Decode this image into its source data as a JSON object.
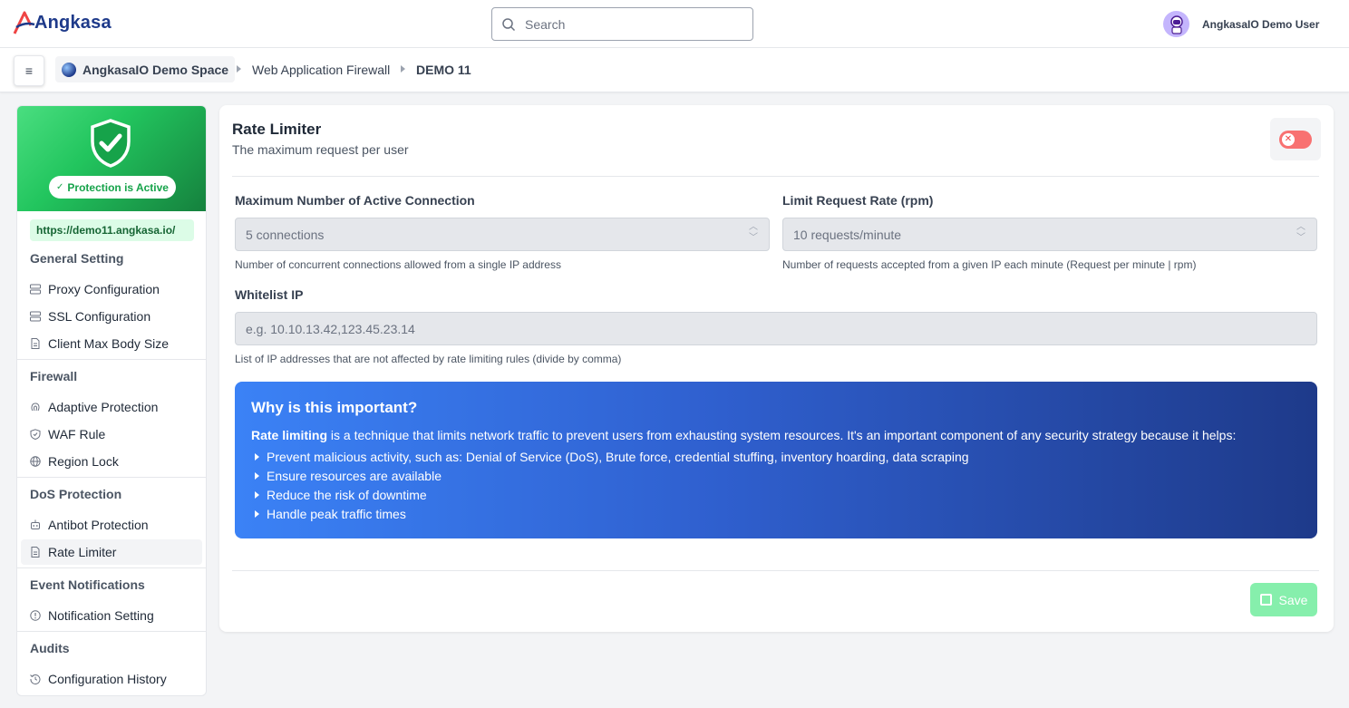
{
  "app": {
    "name": "Angkasa"
  },
  "search": {
    "placeholder": "Search"
  },
  "user": {
    "name": "AngkasaIO Demo User"
  },
  "breadcrumb": {
    "space": "AngkasaIO Demo Space",
    "items": [
      "Web Application Firewall",
      "DEMO 11"
    ]
  },
  "sidebar": {
    "status": "Protection is Active",
    "url": "https://demo11.angkasa.io/",
    "sections": [
      {
        "title": "General Setting",
        "items": [
          "Proxy Configuration",
          "SSL Configuration",
          "Client Max Body Size"
        ]
      },
      {
        "title": "Firewall",
        "items": [
          "Adaptive Protection",
          "WAF Rule",
          "Region Lock"
        ]
      },
      {
        "title": "DoS Protection",
        "items": [
          "Antibot Protection",
          "Rate Limiter"
        ]
      },
      {
        "title": "Event Notifications",
        "items": [
          "Notification Setting"
        ]
      },
      {
        "title": "Audits",
        "items": [
          "Configuration History"
        ]
      }
    ],
    "active_item": "Rate Limiter"
  },
  "main": {
    "title": "Rate Limiter",
    "subtitle": "The maximum request per user",
    "toggle_state": "off",
    "fields": {
      "max_conn": {
        "label": "Maximum Number of Active Connection",
        "value": "5 connections",
        "hint": "Number of concurrent connections allowed from a single IP address"
      },
      "rate": {
        "label": "Limit Request Rate (rpm)",
        "value": "10 requests/minute",
        "hint": "Number of requests accepted from a given IP each minute (Request per minute | rpm)"
      },
      "whitelist": {
        "label": "Whitelist IP",
        "placeholder": "e.g. 10.10.13.42,123.45.23.14",
        "hint": "List of IP addresses that are not affected by rate limiting rules (divide by comma)"
      }
    },
    "info": {
      "title": "Why is this important?",
      "lead_bold": "Rate limiting",
      "lead_rest": " is a technique that limits network traffic to prevent users from exhausting system resources. It's an important component of any security strategy because it helps:",
      "points": [
        "Prevent malicious activity, such as: Denial of Service (DoS), Brute force, credential stuffing, inventory hoarding, data scraping",
        "Ensure resources are available",
        "Reduce the risk of downtime",
        "Handle peak traffic times"
      ]
    },
    "save_label": "Save"
  },
  "colors": {
    "brand": "#1e3a8a",
    "success": "#16a34a",
    "danger": "#f87171",
    "info_start": "#3b82f6",
    "info_end": "#1e3a8a"
  }
}
